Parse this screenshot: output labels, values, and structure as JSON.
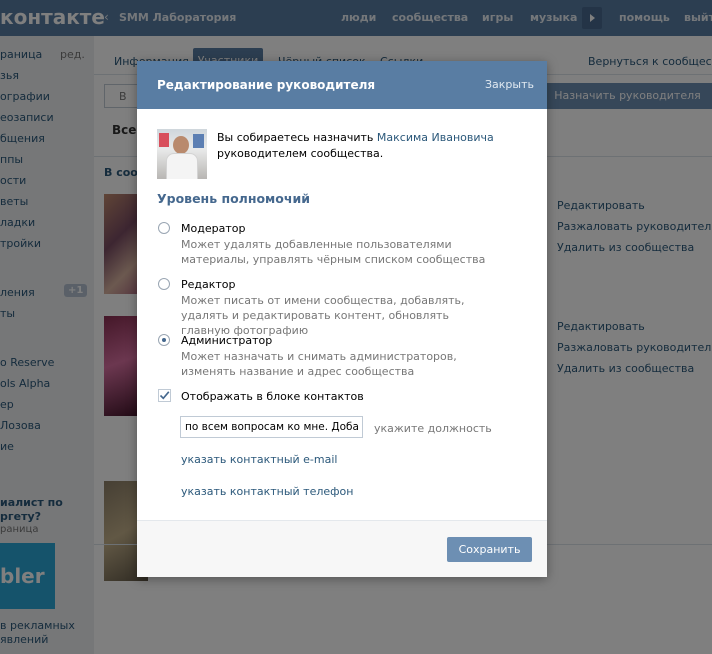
{
  "header": {
    "logo": "контакте",
    "back_icon": "chevron-left-icon",
    "breadcrumb": "SMM Лаборатория",
    "nav": [
      "люди",
      "сообщества",
      "игры",
      "музыка",
      "помощь",
      "выйти"
    ],
    "play_icon": "play-icon"
  },
  "left_menu": {
    "items": [
      "раница",
      "зья",
      "ографии",
      "еозаписи",
      "бщения",
      "ппы",
      "ости",
      "веты",
      "ладки",
      "тройки"
    ],
    "edit_label": "ред.",
    "extra_items": [
      "ления",
      "ты"
    ],
    "badge": "+1",
    "apps": [
      "o Reserve",
      "ols Alpha",
      "ер",
      "Лозова",
      "ие"
    ],
    "ad_title_1": "иалист по",
    "ad_title_2": "ргету?",
    "ad_subtitle": "раница",
    "ad_image_text": "bler",
    "ad_footer_1": "в рекламных",
    "ad_footer_2": "явлений"
  },
  "page": {
    "tabs": [
      "Информация",
      "Участники",
      "Чёрный список",
      "Ссылки"
    ],
    "back_link": "Вернуться к сообществу",
    "search_placeholder": "В",
    "appoint_button": "Назначить руководителя",
    "all_label": "Все",
    "group_label": "В сооб",
    "member_actions": [
      [
        "Редактировать",
        "Разжаловать руководителя",
        "Удалить из сообщества"
      ],
      [
        "Редактировать",
        "Разжаловать руководителя",
        "Удалить из сообщества"
      ]
    ]
  },
  "modal": {
    "title": "Редактирование руководителя",
    "close_label": "Закрыть",
    "intro_before": "Вы собираетесь назначить ",
    "intro_name": "Максима Ивановича",
    "intro_after": "руководителем сообщества.",
    "section_title": "Уровень полномочий",
    "options": [
      {
        "title": "Модератор",
        "description": "Может удалять добавленные пользователями материалы, управлять чёрным списком сообщества",
        "selected": false
      },
      {
        "title": "Редактор",
        "description": "Может писать от имени сообщества, добавлять, удалять и редактировать контент, обновлять главную фотографию",
        "selected": false
      },
      {
        "title": "Администратор",
        "description": "Может назначать и снимать администраторов, изменять название и адрес сообщества",
        "selected": true
      }
    ],
    "show_in_contacts_label": "Отображать в блоке контактов",
    "show_in_contacts_checked": true,
    "position_value": "по всем вопросам ко мне. Добавля",
    "position_hint": "укажите должность",
    "email_link": "указать контактный e-mail",
    "phone_link": "указать контактный телефон",
    "save_button": "Сохранить"
  },
  "colors": {
    "brand": "#597da3",
    "link": "#2b587a",
    "button": "#6d8fb3"
  }
}
